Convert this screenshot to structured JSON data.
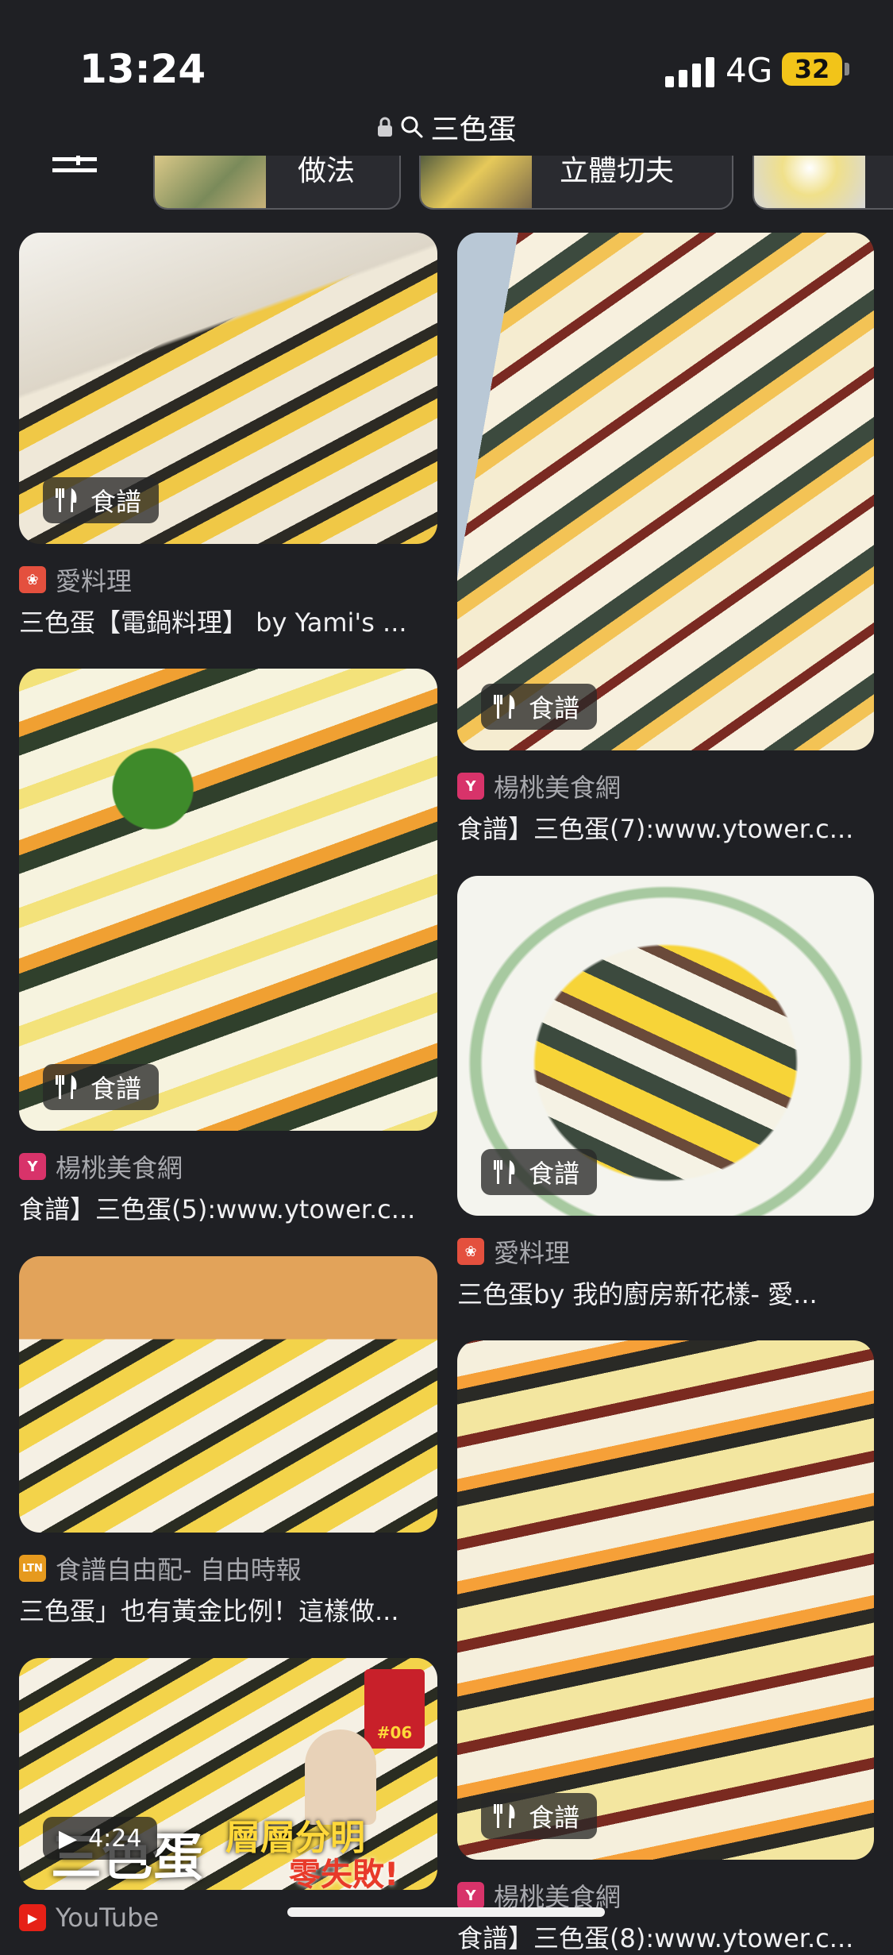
{
  "status": {
    "time": "13:24",
    "network": "4G",
    "battery": "32"
  },
  "url_bar": {
    "query": "三色蛋"
  },
  "chips": [
    {
      "label": ""
    },
    {
      "label": "做法"
    },
    {
      "label": "立體切夫"
    },
    {
      "label": ""
    }
  ],
  "badge": {
    "recipe": "食譜"
  },
  "results": [
    {
      "source": "愛料理",
      "title": "三色蛋【電鍋料理】 by Yami's ...",
      "src_color": "#e4503e",
      "src_glyph": "❀"
    },
    {
      "source": "楊桃美食網",
      "title": "食譜】三色蛋(7):www.ytower.c...",
      "src_color": "#d8336a",
      "src_glyph": "Y"
    },
    {
      "source": "楊桃美食網",
      "title": "食譜】三色蛋(5):www.ytower.c...",
      "src_color": "#d8336a",
      "src_glyph": "Y"
    },
    {
      "source": "愛料理",
      "title": "三色蛋by 我的廚房新花樣- 愛...",
      "src_color": "#e4503e",
      "src_glyph": "❀"
    },
    {
      "source": "食譜自由配- 自由時報",
      "title": "三色蛋」也有黃金比例！這樣做...",
      "src_color": "#e69a1e",
      "src_glyph": "LTN"
    },
    {
      "source": "楊桃美食網",
      "title": "食譜】三色蛋(8):www.ytower.c...",
      "src_color": "#d8336a",
      "src_glyph": "Y"
    },
    {
      "source": "YouTube",
      "title": "",
      "src_color": "#e62117",
      "src_glyph": "▶"
    }
  ],
  "video": {
    "duration": "4:24",
    "overlay_title": "三色蛋",
    "overlay_sub": "層層分明",
    "overlay_sub2": "零失敗!",
    "episode": "#06"
  },
  "colors": {
    "background": "#1f2024",
    "text": "#e8e8ea",
    "muted": "#a8a9ae"
  }
}
